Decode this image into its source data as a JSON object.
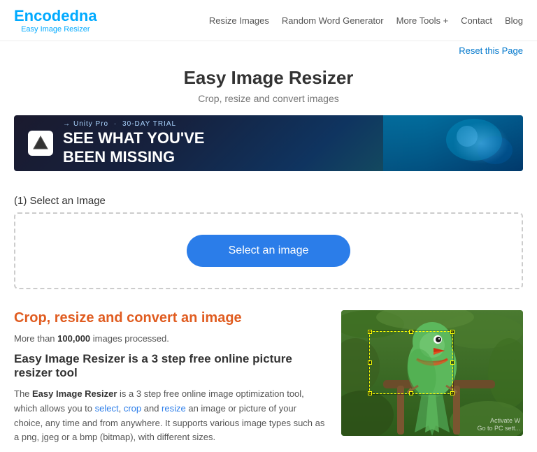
{
  "header": {
    "logo_encode": "Encode",
    "logo_dna": "dna",
    "logo_sub": "Easy Image Resizer",
    "nav": {
      "resize_images": "Resize Images",
      "random_word": "Random Word Generator",
      "more_tools": "More Tools +",
      "contact": "Contact",
      "blog": "Blog"
    },
    "reset_label": "Reset this Page"
  },
  "hero": {
    "title": "Easy Image Resizer",
    "subtitle": "Crop, resize and convert images"
  },
  "banner": {
    "trial": "30-DAY TRIAL",
    "logo_char": "U",
    "product": "Unity Pro",
    "headline_line1": "SEE WHAT YOU'VE",
    "headline_line2": "BEEN MISSING"
  },
  "step": {
    "label": "(1) Select an Image"
  },
  "upload": {
    "button_label": "Select an image"
  },
  "content": {
    "title": "Crop, resize and convert an image",
    "processed": "More than ",
    "processed_count": "100,000",
    "processed_suffix": " images processed.",
    "sub_title": "Easy Image Resizer is a 3 step free online picture resizer tool",
    "desc_intro": "The ",
    "desc_bold": "Easy Image Resizer",
    "desc_text": " is a 3 step free online image optimization tool, which allows you to ",
    "desc_select": "select",
    "desc_comma": ", ",
    "desc_crop": "crop",
    "desc_and": " and ",
    "desc_resize": "resize",
    "desc_end": " an image or picture of your choice, any time and from anywhere. It supports various image types such as a png, jgeg or a bmp (bitmap), with different sizes."
  },
  "watermark": {
    "line1": "Activate W",
    "line2": "Go to PC sett..."
  },
  "colors": {
    "accent_blue": "#2b7de9",
    "accent_orange": "#e05c20",
    "logo_blue": "#00aaff"
  }
}
